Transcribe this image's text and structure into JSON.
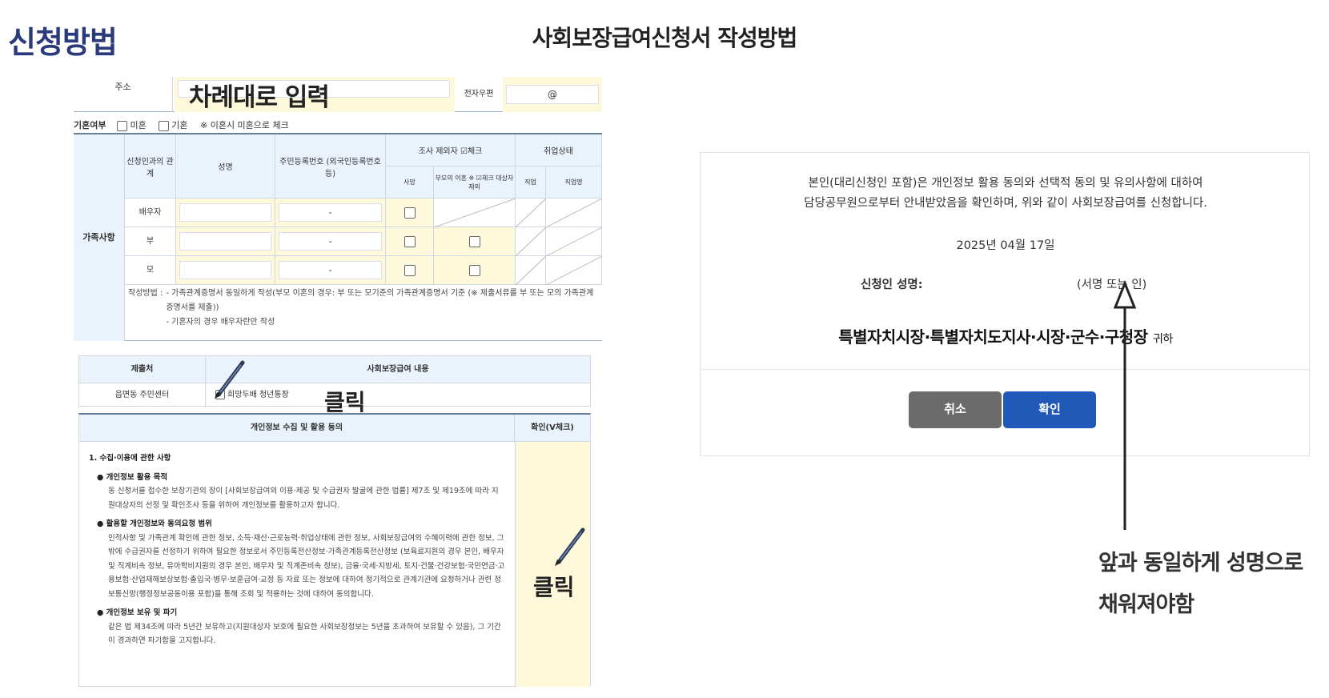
{
  "page_title": "신청방법",
  "slide_heading": "사회보장급여신청서 작성방법",
  "form_a": {
    "address_label": "주소",
    "address_overlay": "차례대로 입력",
    "email_label": "전자우편",
    "email_placeholder": "@",
    "marital": {
      "label": "기혼여부",
      "single": "미혼",
      "married": "기혼",
      "note": "※ 이혼시 미혼으로 체크"
    },
    "family": {
      "side_label": "가족사항",
      "headers": {
        "relation": "신청인과의 관계",
        "name": "성명",
        "resident_id": "주민등록번호 (외국인등록번호 등)",
        "exclude": "조사 제외자 ☑체크",
        "employment": "취업상태"
      },
      "subheaders": {
        "deceased": "사망",
        "divorce": "부모의 이혼 ※ ☑체크 대상자 제외",
        "employed": "직업",
        "jobseeker": "직업명"
      },
      "rows": [
        {
          "relation": "배우자",
          "id_dash": "-"
        },
        {
          "relation": "부",
          "id_dash": "-"
        },
        {
          "relation": "모",
          "id_dash": "-"
        }
      ],
      "note_label": "작성방법 :",
      "notes": [
        "- 가족관계증명서 동일하게 작성(부모 이혼의 경우: 부 또는 모기준의 가족관계증명서 기준 (※ 제출서류를 부 또는 모의 가족관계증명서를 제출))",
        "- 기혼자의 경우 배우자란만 작성"
      ]
    }
  },
  "form_b": {
    "office_header": "제출처",
    "benefit_header": "사회보장급여 내용",
    "office_value": "읍면동 주민센터",
    "benefit_value": "희망두배 청년통장",
    "click_label_1": "클릭",
    "consent_header": "개인정보 수집 및 활용 동의",
    "confirm_header": "확인(V체크)",
    "click_label_2": "클릭",
    "section_title": "1. 수집·이용에 관한 사항",
    "items": [
      {
        "title": "● 개인정보 활용 목적",
        "text": "동 신청서를 접수한 보장기관의 장이 [사회보장급여의 이용·제공 및 수급권자 발굴에 관한 법률] 제7조 및 제19조에 따라 지원대상자의 선정 및 확인조사 등을 위하여 개인정보를 활용하고자 합니다."
      },
      {
        "title": "● 활용할 개인정보와 동의요청 범위",
        "text": "인적사항 및 가족관계 확인에 관한 정보, 소득·재산·근로능력·취업상태에 관한 정보, 사회보장급여의 수혜이력에 관한 정보, 그밖에 수급권자를 선정하기 위하여 필요한 정보로서 주민등록전산정보·가족관계등록전산정보 (보육료지원의 경우 본인, 배우자 및 직계비속 정보, 유아학비지원의 경우 본인, 배우자 및 직계존비속 정보), 금융·국세·지방세, 토지·건물·건강보험·국민연금·고용보험·산업재해보상보험·출입국·병무·보훈급여·교정 등 자료 또는 정보에 대하여 정기적으로 관계기관에 요청하거나 관련 정보통신망(행정정보공동이용 포함)을 통해 조회 및 적용하는 것에 대하여 동의합니다."
      },
      {
        "title": "● 개인정보 보유 및 파기",
        "text": "같은 법 제34조에 따라 5년간 보유하고(지원대상자 보호에 필요한 사회보장정보는 5년을 초과하여 보유할 수 있음), 그 기간이 경과하면 파기함을 고지합니다."
      }
    ]
  },
  "dialog": {
    "message_line1": "본인(대리신청인 포함)은 개인정보 활용 동의와 선택적 동의 및 유의사항에 대하여",
    "message_line2": "담당공무원으로부터 안내받았음을 확인하며, 위와 같이 사회보장급여를 신청합니다.",
    "date": "2025년 04월 17일",
    "signature_label": "신청인 성명:",
    "signature_hint": "(서명 또는 인)",
    "addressee": "특별자치시장·특별자치도지사·시장·군수·구청장",
    "addressee_suffix": "귀하",
    "cancel_button": "취소",
    "confirm_button": "확인"
  },
  "annotation_line1": "앞과 동일하게 성명으로",
  "annotation_line2": "채워져야함",
  "colors": {
    "title_navy": "#2b3a7a",
    "header_blue": "#eaf2fb",
    "input_yellow": "#fff9dc",
    "cancel_gray": "#6b6b6b",
    "confirm_blue": "#2159b8"
  }
}
